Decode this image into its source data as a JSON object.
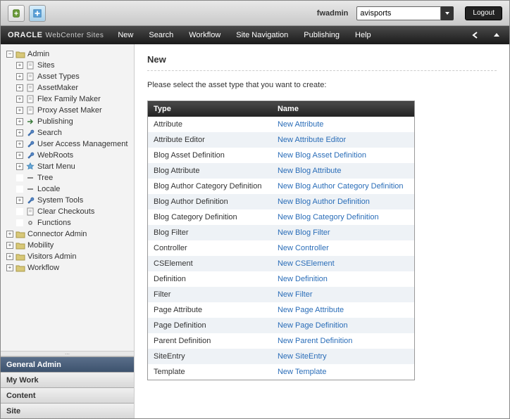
{
  "top": {
    "user_label": "fwadmin",
    "site_value": "avisports",
    "logout": "Logout"
  },
  "brand": {
    "oracle": "ORACLE",
    "product": "WebCenter Sites"
  },
  "menu": {
    "items": [
      "New",
      "Search",
      "Workflow",
      "Site Navigation",
      "Publishing",
      "Help"
    ]
  },
  "tree": {
    "root": "Admin",
    "children": [
      "Sites",
      "Asset Types",
      "AssetMaker",
      "Flex Family Maker",
      "Proxy Asset Maker",
      "Publishing",
      "Search",
      "User Access Management",
      "WebRoots",
      "Start Menu",
      "Tree",
      "Locale",
      "System Tools",
      "Clear Checkouts",
      "Functions"
    ],
    "others": [
      "Connector Admin",
      "Mobility",
      "Visitors Admin",
      "Workflow"
    ]
  },
  "panels": {
    "active": "General Admin",
    "others": [
      "My Work",
      "Content",
      "Site"
    ]
  },
  "page": {
    "title": "New",
    "prompt": "Please select the asset type that you want to create:",
    "col_type": "Type",
    "col_name": "Name",
    "rows": [
      {
        "type": "Attribute",
        "name": "New Attribute"
      },
      {
        "type": "Attribute Editor",
        "name": "New Attribute Editor"
      },
      {
        "type": "Blog Asset Definition",
        "name": "New Blog Asset Definition"
      },
      {
        "type": "Blog Attribute",
        "name": "New Blog Attribute"
      },
      {
        "type": "Blog Author Category Definition",
        "name": "New Blog Author Category Definition"
      },
      {
        "type": "Blog Author Definition",
        "name": "New Blog Author Definition"
      },
      {
        "type": "Blog Category Definition",
        "name": "New Blog Category Definition"
      },
      {
        "type": "Blog Filter",
        "name": "New Blog Filter"
      },
      {
        "type": "Controller",
        "name": "New Controller"
      },
      {
        "type": "CSElement",
        "name": "New CSElement"
      },
      {
        "type": "Definition",
        "name": "New Definition"
      },
      {
        "type": "Filter",
        "name": "New Filter"
      },
      {
        "type": "Page Attribute",
        "name": "New Page Attribute"
      },
      {
        "type": "Page Definition",
        "name": "New Page Definition"
      },
      {
        "type": "Parent Definition",
        "name": "New Parent Definition"
      },
      {
        "type": "SiteEntry",
        "name": "New SiteEntry"
      },
      {
        "type": "Template",
        "name": "New Template"
      }
    ]
  },
  "tree_meta": {
    "expand_plus": [
      true,
      true,
      true,
      true,
      true,
      true,
      true,
      true,
      true,
      true,
      false,
      false,
      true,
      false,
      false
    ],
    "icon": [
      "page",
      "page",
      "page",
      "page",
      "page",
      "arrow",
      "wrench",
      "wrench",
      "wrench",
      "star",
      "line",
      "line",
      "wrench",
      "page",
      "gear"
    ]
  }
}
